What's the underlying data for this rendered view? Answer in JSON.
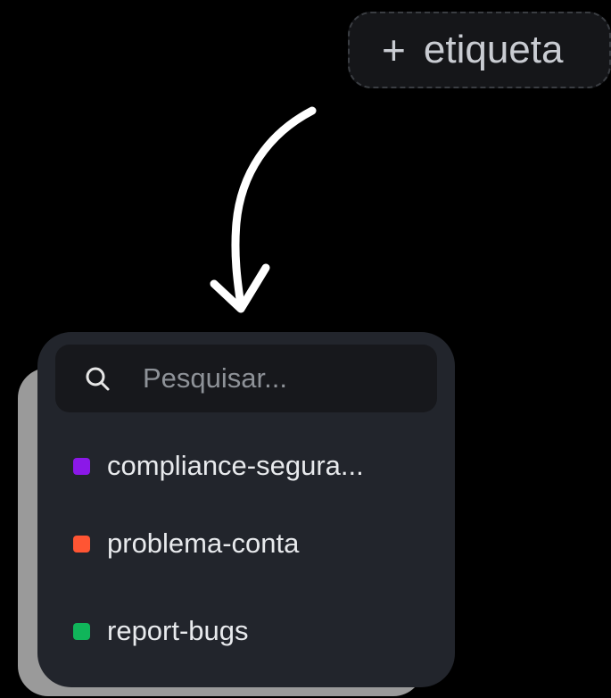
{
  "add_tag_button": {
    "plus": "+",
    "label": "etiqueta"
  },
  "dropdown": {
    "search": {
      "placeholder": "Pesquisar...",
      "value": "",
      "icon": "search-icon"
    },
    "tags": [
      {
        "label": "compliance-segura...",
        "color": "#8b18e8"
      },
      {
        "label": "problema-conta",
        "color": "#ff5533"
      },
      {
        "label": "report-bugs",
        "color": "#10b55a"
      }
    ]
  },
  "annotation": {
    "icon": "curved-arrow-down-icon",
    "color": "#ffffff"
  }
}
